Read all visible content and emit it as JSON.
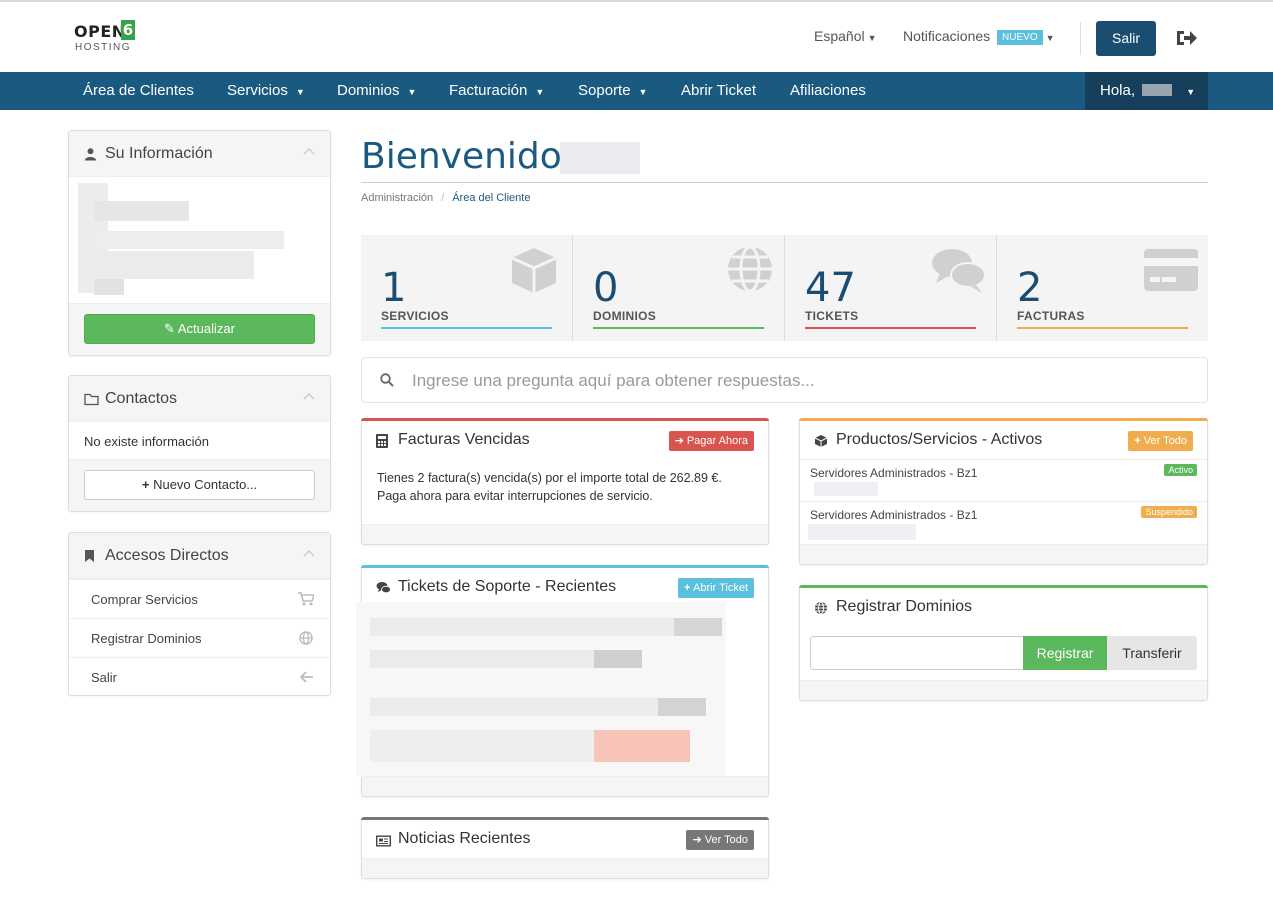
{
  "brand": {
    "logo_top": "OPEN",
    "logo_num": "6",
    "logo_bottom": "HOSTING"
  },
  "header": {
    "language": "Español",
    "notifications": "Notificaciones",
    "new_badge": "NUEVO",
    "logout_button": "Salir"
  },
  "nav": {
    "items": [
      {
        "label": "Área de Clientes",
        "dropdown": false
      },
      {
        "label": "Servicios",
        "dropdown": true
      },
      {
        "label": "Dominios",
        "dropdown": true
      },
      {
        "label": "Facturación",
        "dropdown": true
      },
      {
        "label": "Soporte",
        "dropdown": true
      },
      {
        "label": "Abrir Ticket",
        "dropdown": false
      },
      {
        "label": "Afiliaciones",
        "dropdown": false
      }
    ],
    "greeting": "Hola, "
  },
  "sidebar": {
    "info": {
      "title": "Su Información",
      "update_button": "Actualizar"
    },
    "contacts": {
      "title": "Contactos",
      "empty": "No existe información",
      "new_button": "Nuevo Contacto..."
    },
    "shortcuts": {
      "title": "Accesos Directos",
      "items": [
        {
          "label": "Comprar Servicios",
          "icon": "cart-icon"
        },
        {
          "label": "Registrar Dominios",
          "icon": "globe-icon"
        },
        {
          "label": "Salir",
          "icon": "arrow-left-icon"
        }
      ]
    }
  },
  "main": {
    "welcome": "Bienvenido,",
    "breadcrumb": {
      "home": "Administración",
      "current": "Área del Cliente"
    },
    "stats": [
      {
        "value": "1",
        "label": "SERVICIOS",
        "color": "#5bc0de",
        "icon": "box-icon"
      },
      {
        "value": "0",
        "label": "DOMINIOS",
        "color": "#5cb85c",
        "icon": "globe-icon"
      },
      {
        "value": "47",
        "label": "TICKETS",
        "color": "#d9534f",
        "icon": "comments-icon"
      },
      {
        "value": "2",
        "label": "FACTURAS",
        "color": "#f0ad4e",
        "icon": "credit-card-icon"
      }
    ],
    "search_placeholder": "Ingrese una pregunta aquí para obtener respuestas...",
    "overdue": {
      "title": "Facturas Vencidas",
      "button": "Pagar Ahora",
      "line1": "Tienes 2 factura(s) vencida(s) por el importe total de 262.89 €.",
      "line2": "Paga ahora para evitar interrupciones de servicio."
    },
    "tickets": {
      "title": "Tickets de Soporte - Recientes",
      "button": "Abrir Ticket"
    },
    "news": {
      "title": "Noticias Recientes",
      "button": "Ver Todo"
    },
    "products": {
      "title": "Productos/Servicios - Activos",
      "button": "Ver Todo",
      "rows": [
        {
          "name": "Servidores Administrados - Bz1",
          "status": "Activo",
          "status_color": "#5cb85c"
        },
        {
          "name": "Servidores Administrados - Bz1",
          "status": "Suspendido",
          "status_color": "#f0ad4e"
        }
      ]
    },
    "domains": {
      "title": "Registrar Dominios",
      "register": "Registrar",
      "transfer": "Transferir"
    }
  },
  "colors": {
    "navy": "#1b5a80",
    "dark_navy": "#1b4d72",
    "green": "#5cb85c",
    "red": "#d9534f",
    "blue": "#5bc0de",
    "orange": "#f0ad4e"
  }
}
